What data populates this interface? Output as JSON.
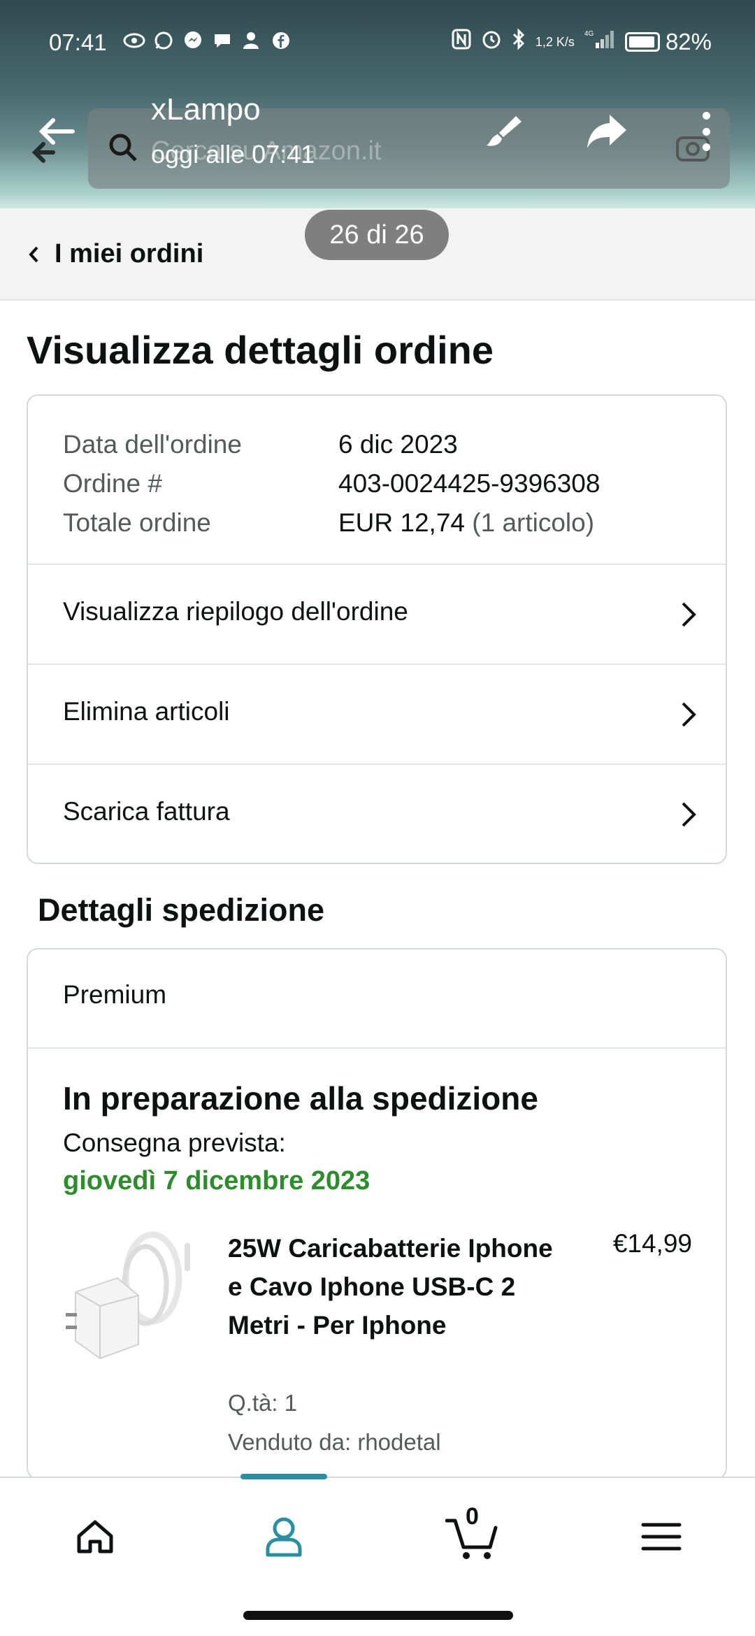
{
  "status_bar": {
    "time": "07:41",
    "notification_icons": [
      "eye-icon",
      "whatsapp-icon",
      "messenger-icon",
      "chat-icon",
      "person-icon",
      "facebook-icon"
    ],
    "speed": "1,2 K/s",
    "network": "4G",
    "battery": "82%",
    "battery_level": 0.82
  },
  "viewer": {
    "title": "xLampo",
    "subtitle": "oggi alle 07:41",
    "page_counter": "26 di 26",
    "search_placeholder": "Cerca su Amazon.it"
  },
  "breadcrumb": {
    "label": "I miei ordini"
  },
  "page": {
    "title": "Visualizza dettagli ordine"
  },
  "order": {
    "date_label": "Data dell'ordine",
    "date_value": "6 dic 2023",
    "number_label": "Ordine #",
    "number_value": "403-0024425-9396308",
    "total_label": "Totale ordine",
    "total_value": "EUR 12,74",
    "total_items": "(1 articolo)",
    "links": [
      {
        "label": "Visualizza riepilogo dell'ordine"
      },
      {
        "label": "Elimina articoli"
      },
      {
        "label": "Scarica fattura"
      }
    ]
  },
  "shipping": {
    "section_title": "Dettagli spedizione",
    "type": "Premium",
    "status": "In preparazione alla spedizione",
    "delivery_label": "Consegna prevista:",
    "delivery_date": "giovedì 7 dicembre 2023",
    "product": {
      "title": "25W Caricabatterie Iphone e Cavo Iphone USB-C 2 Metri - Per Iphone",
      "price": "€14,99",
      "qty": "Q.tà: 1",
      "seller": "Venduto da: rhodetal"
    }
  },
  "bottom_nav": {
    "items": [
      "home-icon",
      "account-icon",
      "cart-icon",
      "menu-icon"
    ],
    "cart_count": "0",
    "active": "account-icon"
  },
  "colors": {
    "delivery_green": "#2d8d2d",
    "nav_accent": "#2a8fa3",
    "text": "#0f1111",
    "muted": "#565959"
  }
}
